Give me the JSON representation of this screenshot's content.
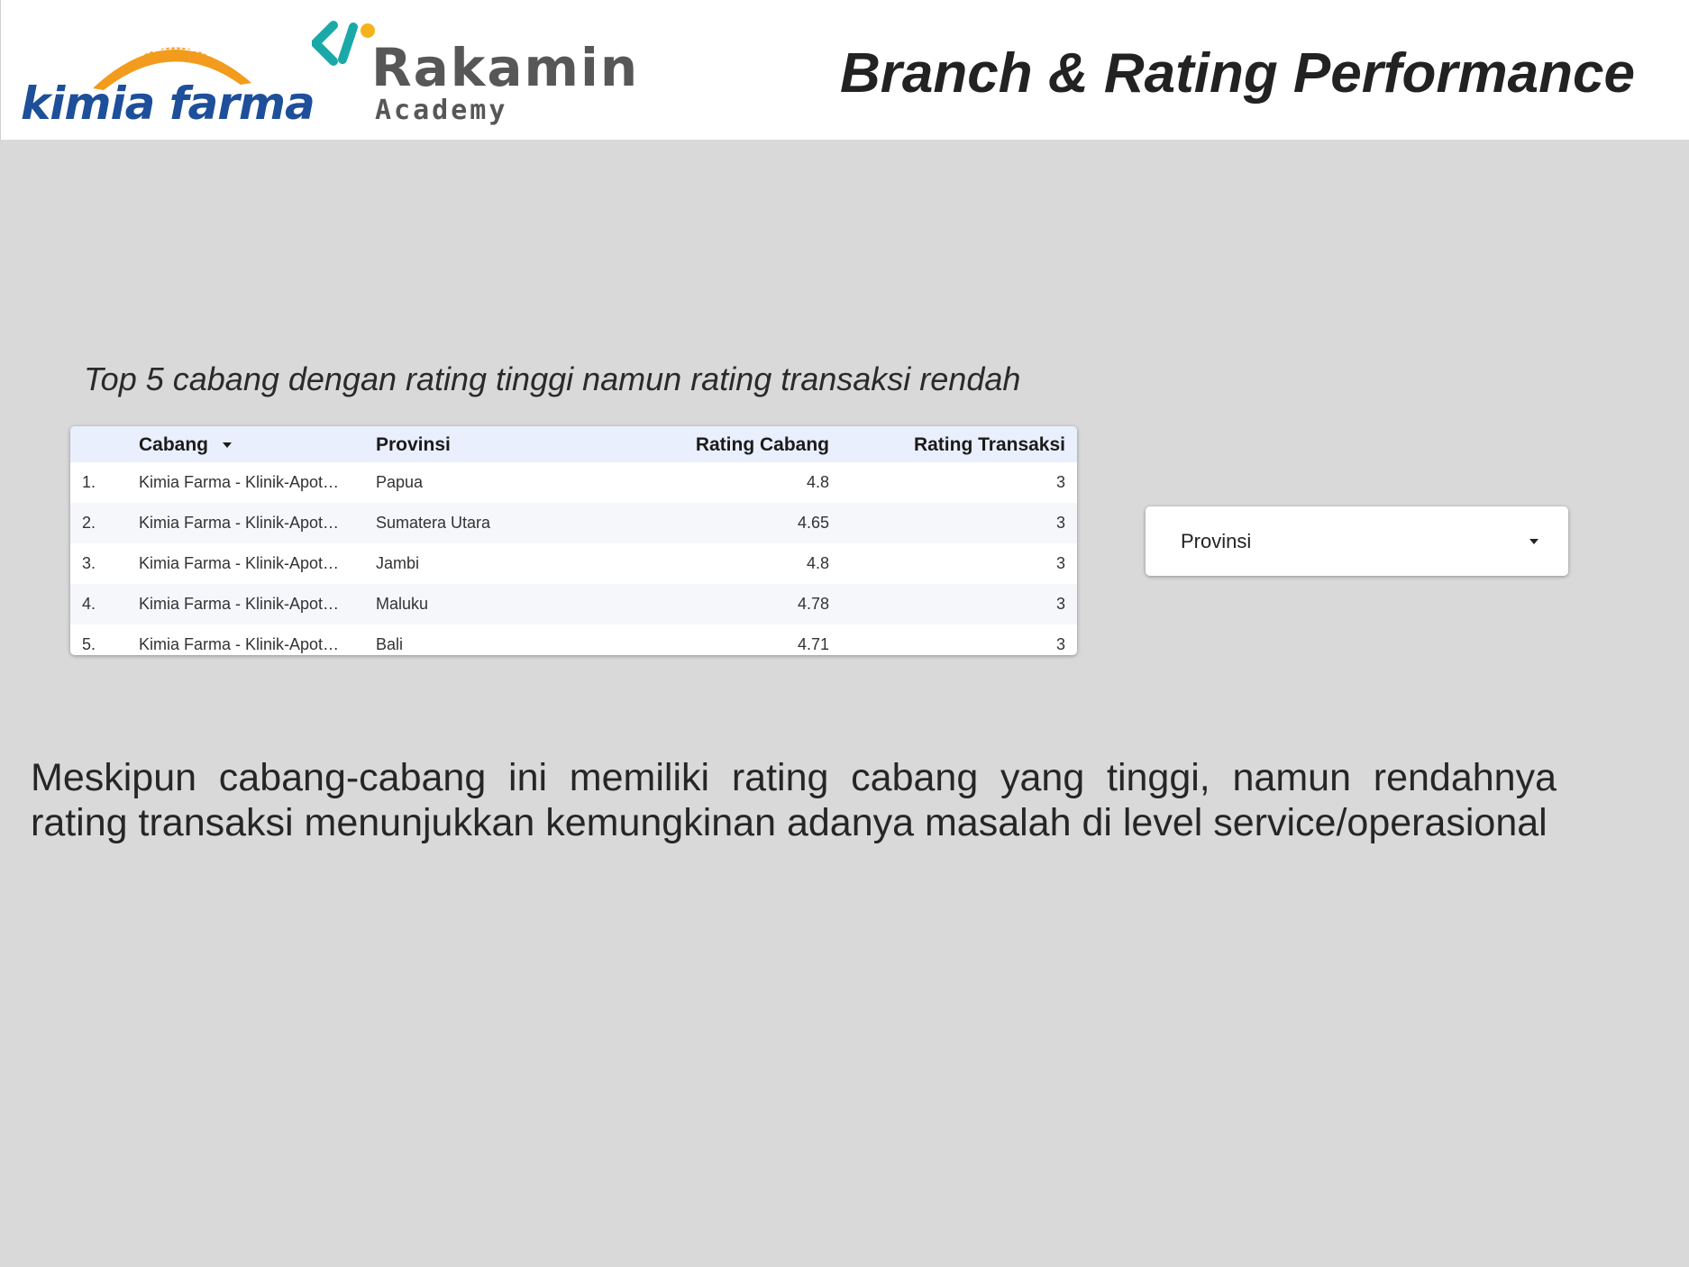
{
  "header": {
    "kimia_farma_logo_text": "kimia farma",
    "rakamin_logo_name": "Rakamin",
    "rakamin_logo_sub": "Academy",
    "title": "Branch & Rating Performance"
  },
  "colors": {
    "background": "#d9d9d9",
    "kimia_farma_blue": "#1d4f9a",
    "kimia_farma_orange": "#f29b1d",
    "rakamin_teal": "#1aa9a8",
    "rakamin_yellow": "#f6b21b",
    "table_header_bg": "#e9effc"
  },
  "table": {
    "title": "Top 5 cabang dengan rating tinggi namun rating transaksi rendah",
    "columns": {
      "cabang": "Cabang",
      "provinsi": "Provinsi",
      "rating_cabang": "Rating Cabang",
      "rating_transaksi": "Rating Transaksi"
    },
    "sort_icon": "caret-down-icon",
    "rows": [
      {
        "num": "1.",
        "cabang": "Kimia Farma - Klinik-Apot…",
        "provinsi": "Papua",
        "rating_cabang": "4.8",
        "rating_transaksi": "3"
      },
      {
        "num": "2.",
        "cabang": "Kimia Farma - Klinik-Apot…",
        "provinsi": "Sumatera Utara",
        "rating_cabang": "4.65",
        "rating_transaksi": "3"
      },
      {
        "num": "3.",
        "cabang": "Kimia Farma - Klinik-Apot…",
        "provinsi": "Jambi",
        "rating_cabang": "4.8",
        "rating_transaksi": "3"
      },
      {
        "num": "4.",
        "cabang": "Kimia Farma - Klinik-Apot…",
        "provinsi": "Maluku",
        "rating_cabang": "4.78",
        "rating_transaksi": "3"
      },
      {
        "num": "5.",
        "cabang": "Kimia Farma - Klinik-Apot…",
        "provinsi": "Bali",
        "rating_cabang": "4.71",
        "rating_transaksi": "3"
      }
    ]
  },
  "filter": {
    "label": "Provinsi",
    "icon": "caret-down-icon"
  },
  "insight": {
    "text": "Meskipun cabang-cabang ini memiliki rating cabang yang tinggi, namun rendahnya rating transaksi menunjukkan kemungkinan adanya masalah di level service/operasional"
  }
}
